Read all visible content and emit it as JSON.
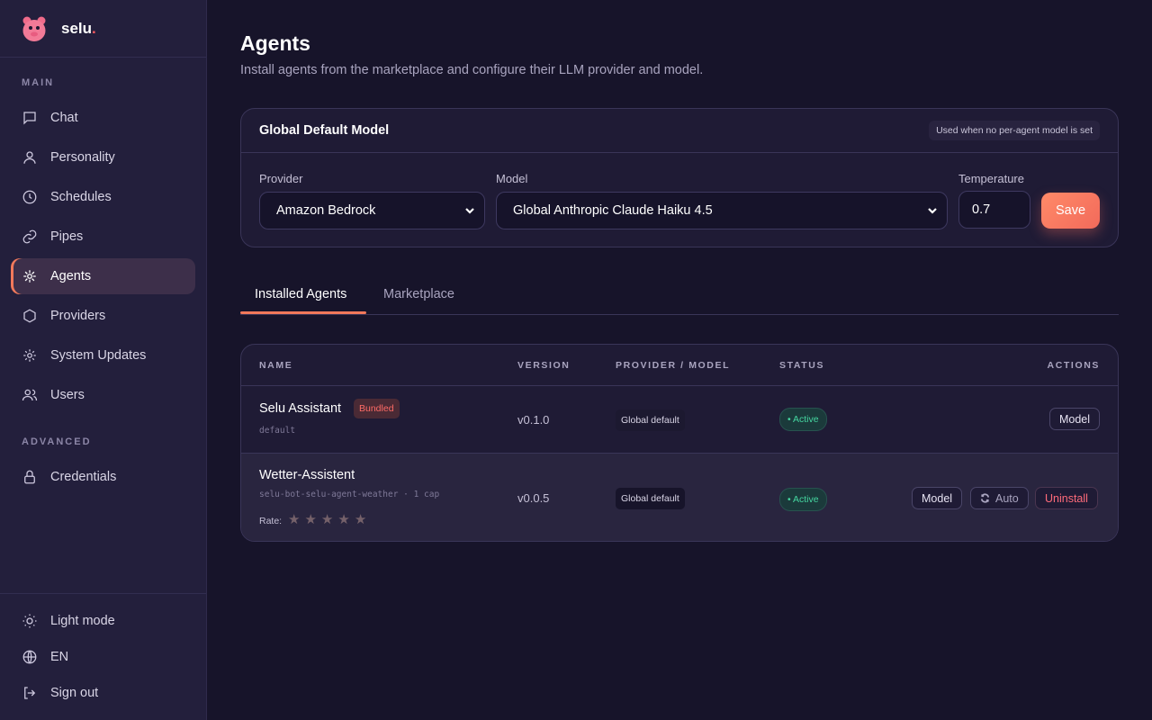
{
  "brand": {
    "name": "selu",
    "dot": "."
  },
  "sidebar": {
    "main_label": "MAIN",
    "advanced_label": "ADVANCED",
    "items": [
      {
        "label": "Chat",
        "icon": "chat-icon"
      },
      {
        "label": "Personality",
        "icon": "user-icon"
      },
      {
        "label": "Schedules",
        "icon": "clock-icon"
      },
      {
        "label": "Pipes",
        "icon": "link-icon"
      },
      {
        "label": "Agents",
        "icon": "agents-icon",
        "active": true
      },
      {
        "label": "Providers",
        "icon": "hexagon-icon"
      },
      {
        "label": "System Updates",
        "icon": "gear-icon"
      },
      {
        "label": "Users",
        "icon": "users-icon"
      }
    ],
    "advanced_items": [
      {
        "label": "Credentials",
        "icon": "lock-icon"
      }
    ],
    "bottom_items": [
      {
        "label": "Light mode",
        "icon": "sun-icon"
      },
      {
        "label": "EN",
        "icon": "globe-icon"
      },
      {
        "label": "Sign out",
        "icon": "sign-out-icon"
      }
    ]
  },
  "page": {
    "title": "Agents",
    "subtitle": "Install agents from the marketplace and configure their LLM provider and model."
  },
  "global_model": {
    "title": "Global Default Model",
    "hint": "Used when no per-agent model is set",
    "provider_label": "Provider",
    "provider_value": "Amazon Bedrock",
    "model_label": "Model",
    "model_value": "Global Anthropic Claude Haiku 4.5",
    "temperature_label": "Temperature",
    "temperature_value": "0.7",
    "save_label": "Save"
  },
  "tabs": [
    {
      "label": "Installed Agents",
      "active": true
    },
    {
      "label": "Marketplace",
      "active": false
    }
  ],
  "table": {
    "headers": [
      "NAME",
      "VERSION",
      "PROVIDER / MODEL",
      "STATUS",
      "ACTIONS"
    ],
    "rows": [
      {
        "name": "Selu Assistant",
        "badge": "Bundled",
        "id": "default",
        "version": "v0.1.0",
        "provider": "Global default",
        "status": "• Active",
        "actions": [
          "Model"
        ]
      },
      {
        "name": "Wetter-Assistent",
        "id": "selu-bot-selu-agent-weather · 1 cap",
        "rate_label": "Rate:",
        "rating": 0,
        "version": "v0.0.5",
        "provider": "Global default",
        "status": "• Active",
        "actions": [
          "Model",
          "Auto",
          "Uninstall"
        ]
      }
    ]
  },
  "colors": {
    "accent": "#f2795b",
    "background": "#17142a",
    "sidebar": "#231f3c",
    "status_active": "#45d6a0",
    "danger": "#ff6b7a"
  }
}
